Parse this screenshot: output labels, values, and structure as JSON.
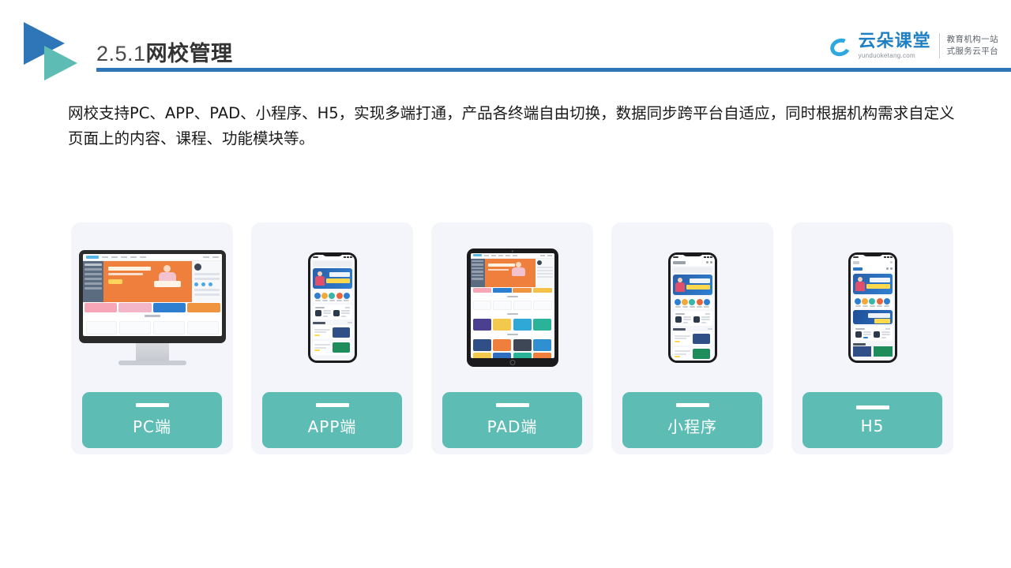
{
  "slide": {
    "header": {
      "section_number": "2.5.1",
      "title_cn": "网校管理",
      "logo_icon": "double-triangle-play-logo",
      "rule_color": "#2f76b8"
    },
    "brand": {
      "icon": "cloud-icon",
      "name": "云朵课堂",
      "url": "yunduoketang.com",
      "slogan_line1": "教育机构一站",
      "slogan_line2": "式服务云平台",
      "brand_color": "#1f7fc4"
    },
    "lead_paragraph": "网校支持PC、APP、PAD、小程序、H5，实现多端打通，产品各终端自由切换，数据同步跨平台自适应，同时根据机构需求自定义页面上的内容、课程、功能模块等。",
    "accent_color": "#5dbdb4",
    "card_bg_color": "#f3f5fa",
    "cards": [
      {
        "label": "PC端",
        "device": "desktop-monitor",
        "icon": "monitor-icon"
      },
      {
        "label": "APP端",
        "device": "smartphone",
        "icon": "phone-icon"
      },
      {
        "label": "PAD端",
        "device": "tablet",
        "icon": "tablet-icon"
      },
      {
        "label": "小程序",
        "device": "smartphone",
        "icon": "phone-icon"
      },
      {
        "label": "H5",
        "device": "smartphone",
        "icon": "phone-icon"
      }
    ]
  }
}
